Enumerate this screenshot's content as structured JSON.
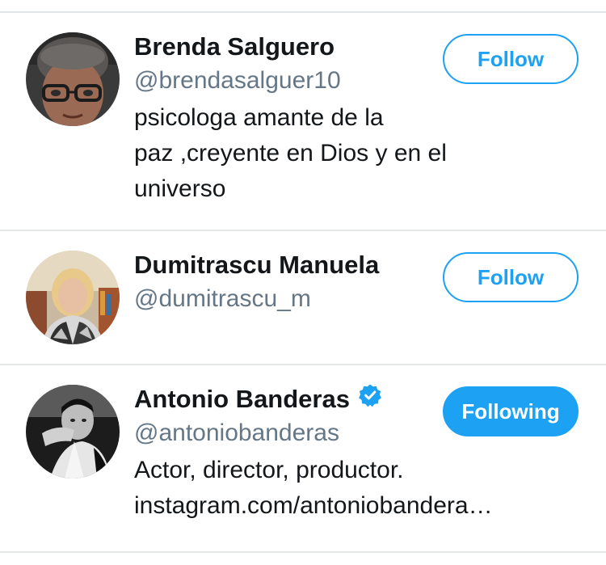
{
  "users": [
    {
      "name": "Brenda Salguero",
      "handle": "@brendasalguer10",
      "bio_lines": [
        "psicologa amante de la",
        "paz ,creyente en Dios y en el",
        "universo"
      ],
      "button_label": "Follow",
      "following": false,
      "verified": false
    },
    {
      "name": "Dumitrascu Manuela",
      "handle": "@dumitrascu_m",
      "bio_lines": [],
      "button_label": "Follow",
      "following": false,
      "verified": false
    },
    {
      "name": "Antonio Banderas",
      "handle": "@antoniobanderas",
      "bio_lines": [
        "Actor, director, productor.",
        "instagram.com/antoniobandera…"
      ],
      "button_label": "Following",
      "following": true,
      "verified": true
    }
  ],
  "colors": {
    "accent": "#1da1f2",
    "handle_text": "#657786",
    "primary_text": "#14171a",
    "divider": "#e3e6e8"
  },
  "icons": {
    "verified": "verified-badge-icon"
  }
}
